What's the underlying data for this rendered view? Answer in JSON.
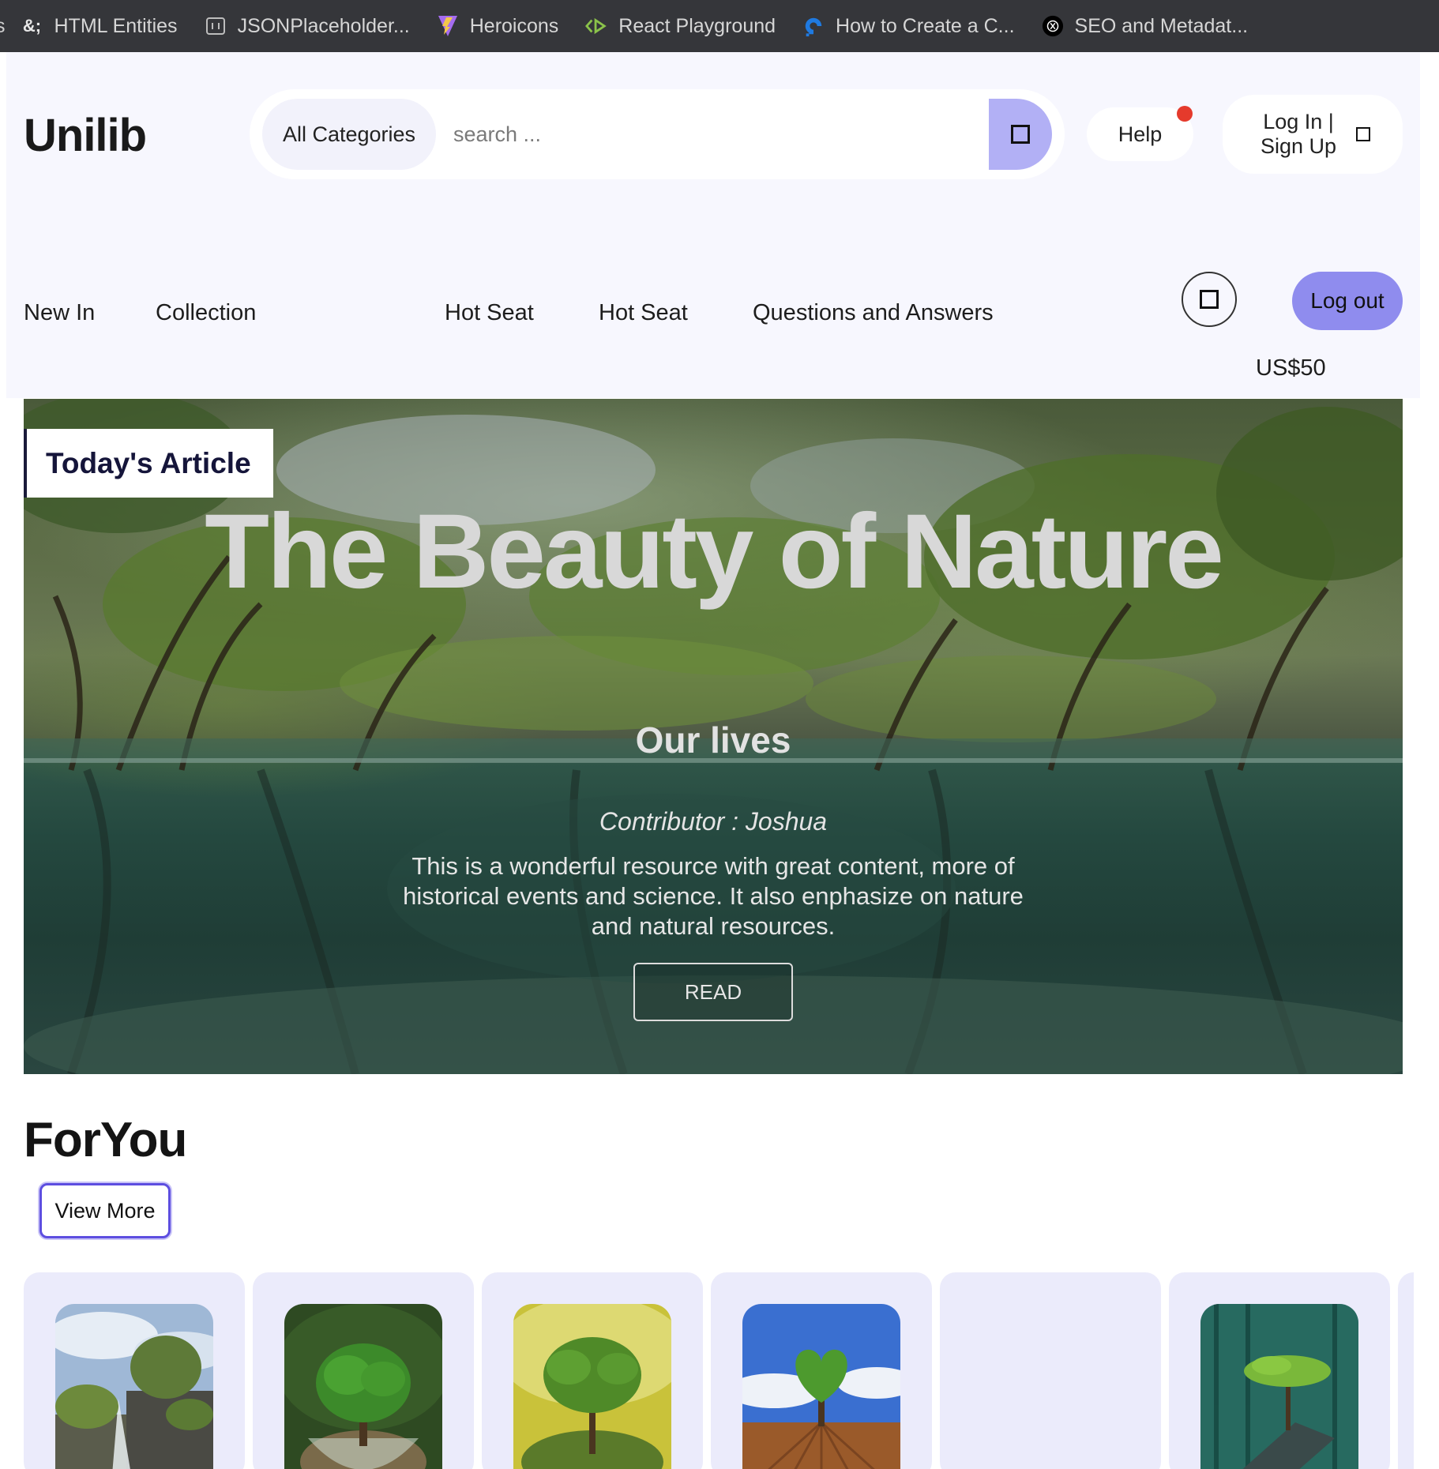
{
  "bookmarks": {
    "partial_label": "s",
    "items": [
      {
        "label": "HTML Entities",
        "icon": "ampersand-icon",
        "icon_text": "&;"
      },
      {
        "label": "JSONPlaceholder...",
        "icon": "json-icon"
      },
      {
        "label": "Heroicons",
        "icon": "heroicons-logo-icon"
      },
      {
        "label": "React Playground",
        "icon": "code-arrow-icon"
      },
      {
        "label": "How to Create a C...",
        "icon": "digitalocean-icon"
      },
      {
        "label": "SEO and Metadat...",
        "icon": "black-circle-logo-icon"
      }
    ]
  },
  "header": {
    "logo": "Unilib",
    "search": {
      "category_label": "All Categories",
      "placeholder": "search ...",
      "value": ""
    },
    "help_label": "Help",
    "login_label": "Log In | Sign Up",
    "notification_color": "#e53a2c"
  },
  "nav": {
    "items": [
      "New In",
      "Collection",
      "Hot Seat",
      "Hot Seat",
      "Questions and Answers"
    ],
    "logout_label": "Log out",
    "balance": "US$50"
  },
  "hero": {
    "tag": "Today's Article",
    "title": "The Beauty of Nature",
    "subtitle": "Our lives",
    "contributor": "Contributor : Joshua",
    "description": "This is a wonderful resource with great content, more of historical events and science. It also enphasize on nature and natural resources.",
    "read_label": "READ"
  },
  "foryou": {
    "title": "ForYou",
    "view_more_label": "View More",
    "cards": [
      {
        "image": "waterfall-trees"
      },
      {
        "image": "tree-in-broken-glass-globe"
      },
      {
        "image": "tree-on-moss-in-hand"
      },
      {
        "image": "heart-shaped-tree-field"
      },
      {
        "image": ""
      },
      {
        "image": "small-tree-on-rock-water"
      }
    ]
  },
  "colors": {
    "accent": "#8f8cee",
    "accent_light": "#b2b0f5",
    "view_more_border": "#5d4ee0",
    "header_bg": "#f7f7fe",
    "card_bg": "#ebebfb"
  }
}
